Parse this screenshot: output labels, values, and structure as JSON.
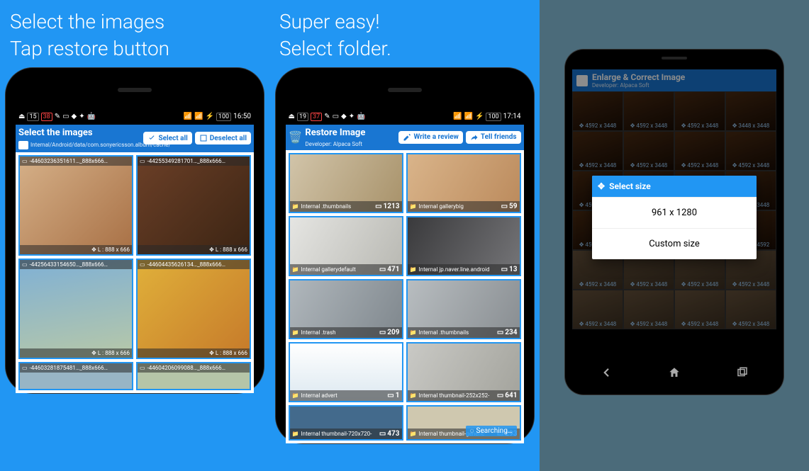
{
  "panel1": {
    "caption_line1": "Select the images",
    "caption_line2": "Tap restore button",
    "status": {
      "badge1": "15",
      "badge2": "38",
      "time": "16:50",
      "batt": "100"
    },
    "appbar": {
      "title": "Select the images",
      "subtitle": "Internal/Android/data/com.sonyericsson.album/cache/",
      "btn1": "Select all",
      "btn2": "Deselect all"
    },
    "images": [
      {
        "file": "-44603236351611…_888x666…",
        "size": "L : 888 x 666"
      },
      {
        "file": "-44255349281701…_888x666…",
        "size": "L : 888 x 666"
      },
      {
        "file": "-44256433154650…_888x666…",
        "size": "L : 888 x 666"
      },
      {
        "file": "-44604435626134…_888x666…",
        "size": "L : 888 x 666"
      },
      {
        "file": "-44603281875481…_888x666…",
        "size": ""
      },
      {
        "file": "-44604206099088…_888x666…",
        "size": ""
      }
    ]
  },
  "panel2": {
    "caption_line1": "Super easy!",
    "caption_line2": "Select folder.",
    "status": {
      "badge1": "19",
      "badge2": "37",
      "time": "17:14",
      "batt": "100"
    },
    "appbar": {
      "title": "Restore Image",
      "subtitle": "Developer: Alpaca Soft",
      "btn1": "Write a review",
      "btn2": "Tell friends"
    },
    "folders": [
      {
        "name": "Internal .thumbnails",
        "count": "1213"
      },
      {
        "name": "Internal gallerybig",
        "count": "59"
      },
      {
        "name": "Internal gallerydefault",
        "count": "471"
      },
      {
        "name": "Internal jp.naver.line.android",
        "count": "13"
      },
      {
        "name": "Internal .trash",
        "count": "209"
      },
      {
        "name": "Internal .thumbnails",
        "count": "234"
      },
      {
        "name": "Internal advert",
        "count": "1"
      },
      {
        "name": "Internal thumbnail-252x252-",
        "count": "641"
      },
      {
        "name": "Internal thumbnail-720x720-",
        "count": "473"
      },
      {
        "name": "Internal thumbnail-generic",
        "count": "293"
      }
    ],
    "searching": "Searching…"
  },
  "panel3": {
    "appbar": {
      "title": "Enlarge & Correct Image",
      "subtitle": "Developer: Alpaca Soft"
    },
    "cell_size": "4592 x 3448",
    "cell_size_alt1": "3448 x 4592",
    "cell_size_alt2": "3448 x 3448",
    "modal": {
      "title": "Select size",
      "opt1": "961 x 1280",
      "opt2": "Custom size"
    }
  }
}
